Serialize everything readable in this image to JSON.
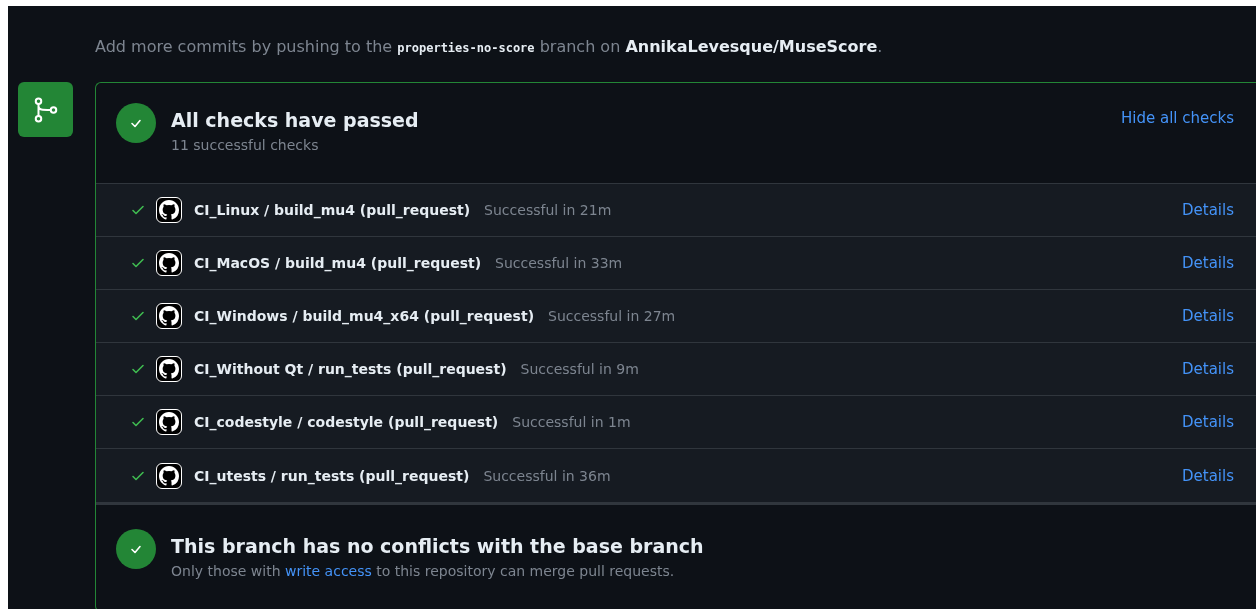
{
  "intro": {
    "before": "Add more commits by pushing to the ",
    "branch": "properties-no-score",
    "middle": " branch on ",
    "repo": "AnnikaLevesque/MuseScore",
    "after": "."
  },
  "checks_summary": {
    "title": "All checks have passed",
    "subtitle": "11 successful checks",
    "toggle": "Hide all checks"
  },
  "checks": [
    {
      "name": "CI_Linux / build_mu4 (pull_request)",
      "status": "Successful in 21m",
      "link": "Details"
    },
    {
      "name": "CI_MacOS / build_mu4 (pull_request)",
      "status": "Successful in 33m",
      "link": "Details"
    },
    {
      "name": "CI_Windows / build_mu4_x64 (pull_request)",
      "status": "Successful in 27m",
      "link": "Details"
    },
    {
      "name": "CI_Without Qt / run_tests (pull_request)",
      "status": "Successful in 9m",
      "link": "Details"
    },
    {
      "name": "CI_codestyle / codestyle (pull_request)",
      "status": "Successful in 1m",
      "link": "Details"
    },
    {
      "name": "CI_utests / run_tests (pull_request)",
      "status": "Successful in 36m",
      "link": "Details"
    }
  ],
  "merge": {
    "title": "This branch has no conflicts with the base branch",
    "before": "Only those with ",
    "link": "write access",
    "after": " to this repository can merge pull requests."
  }
}
